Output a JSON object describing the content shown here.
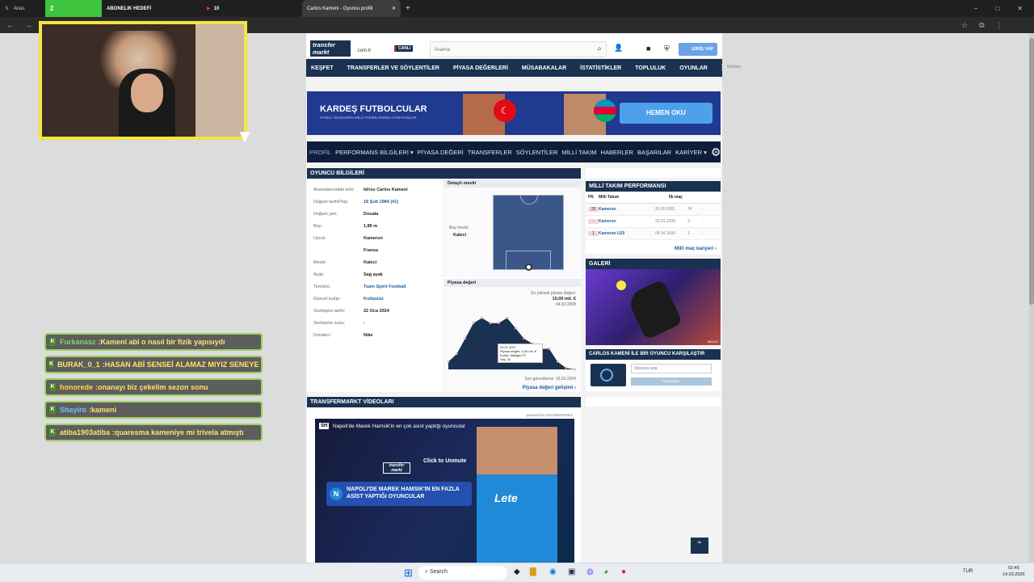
{
  "browser": {
    "tabs": [
      "Anas",
      "2",
      "ABONELIK HEDEFİ",
      "10",
      "Carlos Kameni - Oyuncu profili"
    ],
    "win_controls": [
      "−",
      "□",
      "✕"
    ]
  },
  "site": {
    "logo_line1": "transfer",
    "logo_line2": "markt",
    "domain": ".com.tr",
    "live": "CANLI",
    "search_placeholder": "Arama",
    "login": "GİRİŞ YAP",
    "ad_label": "Reklam"
  },
  "nav": [
    "KEŞFET",
    "TRANSFERLER VE SÖYLENTİLER",
    "PİYASA DEĞERLERİ",
    "MÜSABAKALAR",
    "İSTATİSTİKLER",
    "TOPLULUK",
    "OYUNLAR"
  ],
  "banner": {
    "title": "KARDEŞ FUTBOLCULAR",
    "subtitle": "FARKLI ÜLKELERİN MİLLİ TAKIMLARINDA OYNAYANLAR",
    "cta": "HEMEN OKU"
  },
  "subnav": [
    "PROFİL",
    "PERFORMANS BİLGİLERİ ▾",
    "PİYASA DEĞERİ",
    "TRANSFERLER",
    "SÖYLENTİLER",
    "MİLLİ TAKIM",
    "HABERLER",
    "BAŞARILAR",
    "KARİYER ▾"
  ],
  "info": {
    "title": "OYUNCU BİLGİLERİ",
    "rows": [
      [
        "Anavatanındaki isim:",
        "Idriss Carlos Kameni"
      ],
      [
        "Doğum tarihi/Yaş:",
        "18 Şub 1984 (41)"
      ],
      [
        "Doğum yeri:",
        "Douala"
      ],
      [
        "Boy:",
        "1,86 m"
      ],
      [
        "Uyruk:",
        "Kamerun"
      ],
      [
        "",
        "Fransa"
      ],
      [
        "Mevki:",
        "Kaleci"
      ],
      [
        "Ayak:",
        "Sağ ayak"
      ],
      [
        "Temsilci:",
        "Team Spirit Football"
      ],
      [
        "Güncel kulüp:",
        "Kulüpsüz"
      ],
      [
        "Sözleşme tarihi:",
        "22 Oca 2024"
      ],
      [
        "Sözleşme sonu:",
        "-"
      ],
      [
        "Donatıcı:",
        "Nike"
      ]
    ],
    "pos_title": "Detaylı mevki",
    "main_pos_label": "Baş mevki:",
    "main_pos": "Kaleci",
    "mv_title": "Piyasa değeri",
    "mv_high_label": "En yüksek piyasa değeri:",
    "mv_high": "10,00 mil. €",
    "mv_high_date": "04.02.2008",
    "mv_tip_date": "24.01.2017",
    "mv_tip_value": "Piyasa değeri: 4,00 mil. €",
    "mv_tip_club": "Kulüp: Málaga CF",
    "mv_tip_age": "Yaş: 32",
    "mv_updated": "Son güncelleme: 19.03.2024",
    "mv_link": "Piyasa değeri gelişimi ›"
  },
  "national": {
    "title": "MİLLİ TAKIM PERFORMANSI",
    "headers": [
      "FN",
      "Milli Takım",
      "İlk maç"
    ],
    "rows": [
      [
        "23",
        "Kamerun",
        "25.05.2001",
        "74",
        "-"
      ],
      [
        "-",
        "Kamerun",
        "23.01.2008",
        "3",
        "-"
      ],
      [
        "1",
        "Kamerun U20",
        "05.04.1999",
        "1",
        "-"
      ]
    ],
    "link": "Milli maç kariyeri ›"
  },
  "gallery": {
    "title": "GALERİ",
    "credit": "IMAGO"
  },
  "compare": {
    "title": "CARLOS KAMENİ İLE BİR OYUNCU KARŞILAŞTIR",
    "placeholder": "Oyuncu ara",
    "button": "Karşılaştır"
  },
  "videos": {
    "title": "TRANSFERMARKT VİDEOLARI",
    "powered": "powered by SHOWHEROES",
    "video_title": "Napoli'de Marek Hamsik'in en çok asist yaptığı oyuncular",
    "unmute": "Click to Unmute",
    "overlay": "NAPOLI'DE MAREK HAMSIK'IN EN FAZLA ASİST YAPTIĞI OYUNCULAR",
    "logo1": "transfer",
    "logo2": "markt"
  },
  "chat": [
    [
      "Furkanasz",
      "Kameni abi o nasıl bir fizik yapısıydı"
    ],
    [
      "BURAK_0_1",
      "HASAN ABİ SENSEİ ALAMAZ MIYIZ SENEYE 👋"
    ],
    [
      "honorede",
      "onanayı biz çekelim sezon sonu"
    ],
    [
      "Shayiro",
      "kameni"
    ],
    [
      "atiba1903atiba",
      "quaresma kameniye mi trivela atmıştı"
    ]
  ],
  "taskbar": {
    "search": "Search",
    "lang": "TUR",
    "time": "02:45",
    "date": "14.03.2026"
  },
  "chart_data": {
    "type": "area",
    "title": "Piyasa değeri",
    "points": [
      {
        "x": "2004",
        "y": 1.5
      },
      {
        "x": "2005",
        "y": 3
      },
      {
        "x": "2006",
        "y": 6
      },
      {
        "x": "2007",
        "y": 9
      },
      {
        "x": "2008",
        "y": 10
      },
      {
        "x": "2009",
        "y": 9
      },
      {
        "x": "2010",
        "y": 9
      },
      {
        "x": "2011",
        "y": 10
      },
      {
        "x": "2012",
        "y": 8
      },
      {
        "x": "2013",
        "y": 6
      },
      {
        "x": "2014",
        "y": 5
      },
      {
        "x": "2016",
        "y": 4
      },
      {
        "x": "2017",
        "y": 4
      },
      {
        "x": "2018",
        "y": 1.5
      },
      {
        "x": "2020",
        "y": 0.3
      },
      {
        "x": "2024",
        "y": 0
      }
    ],
    "ylim": [
      0,
      11
    ],
    "color": "#1a3151"
  }
}
